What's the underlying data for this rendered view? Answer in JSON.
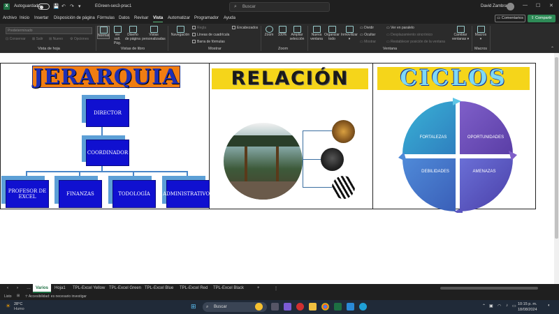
{
  "titlebar": {
    "autosave_label": "Autoguardado",
    "filename": "EGreen-ses3-prac1",
    "search_placeholder": "Buscar",
    "user": "David Zambrano"
  },
  "menu": {
    "tabs": [
      "Archivo",
      "Inicio",
      "Insertar",
      "Disposición de página",
      "Fórmulas",
      "Datos",
      "Revisar",
      "Vista",
      "Automatizar",
      "Programador",
      "Ayuda"
    ],
    "active": "Vista",
    "comments": "Comentarios",
    "share": "Compartir"
  },
  "ribbon": {
    "sheetview_box": "Predeterminado",
    "sheetview_buttons": [
      "Conservar",
      "Salir",
      "Nuevo",
      "Opciones"
    ],
    "groups": [
      "Vista de hoja",
      "Vistas de libro",
      "Mostrar",
      "Zoom",
      "Ventana",
      "Macros"
    ],
    "book_views": [
      {
        "l1": "Normal",
        "l2": ""
      },
      {
        "l1": "Ver salt.",
        "l2": "Pág."
      },
      {
        "l1": "Diseño",
        "l2": "de página"
      },
      {
        "l1": "Vistas",
        "l2": "personalizadas"
      }
    ],
    "navigation": "Navegación",
    "show_checks": [
      "Regla",
      "Líneas de cuadrícula",
      "Barra de fórmulas",
      "Encabezados"
    ],
    "zoom_buttons": [
      {
        "l1": "Zoom",
        "l2": ""
      },
      {
        "l1": "100%",
        "l2": ""
      },
      {
        "l1": "Ampliar",
        "l2": "selección"
      }
    ],
    "window_buttons": [
      {
        "l1": "Nueva",
        "l2": "ventana"
      },
      {
        "l1": "Organizar",
        "l2": "todo"
      },
      {
        "l1": "Inmovilizar",
        "l2": "▾"
      }
    ],
    "window_small": [
      "Dividir",
      "Ocultar",
      "Mostrar"
    ],
    "window_side": [
      "Ver en paralelo",
      "Desplazamiento sincrónico",
      "Restablecer posición de la ventana"
    ],
    "switch_windows": {
      "l1": "Cambiar",
      "l2": "ventanas ▾"
    },
    "macros": "Macros"
  },
  "sheet": {
    "hierarchy": {
      "title": "JERARQUIA",
      "director": "DIRECTOR",
      "coordinator": "COORDINADOR",
      "children": [
        "PROFESOR DE EXCEL",
        "FINANZAS",
        "TODOLOGÍA",
        "ADMINISTRATIVOS"
      ]
    },
    "relation": {
      "title": "RELACIÓN"
    },
    "cycles": {
      "title": "CICLOS",
      "quadrants": [
        "FORTALEZAS",
        "OPORTUNIDADES",
        "DEBILIDADES",
        "AMENAZAS"
      ],
      "colors": [
        "#3b9fcf",
        "#6a4fb8",
        "#4a77c8",
        "#5b5fc8"
      ]
    }
  },
  "sheet_tabs": {
    "tabs": [
      "Varios",
      "Hoja1",
      "TPL-Excel Yellow",
      "TPL-Excel Green",
      "TPL-Excel Blue",
      "TPL-Excel Red",
      "TPL-Excel Black"
    ],
    "active": "Varios"
  },
  "status": {
    "ready": "Listo",
    "accessibility": "Accesibilidad: es necesario investigar"
  },
  "taskbar": {
    "weather_temp": "28°C",
    "weather_desc": "Humo",
    "search": "Buscar",
    "time": "10:15 p. m.",
    "date": "18/08/2024"
  }
}
